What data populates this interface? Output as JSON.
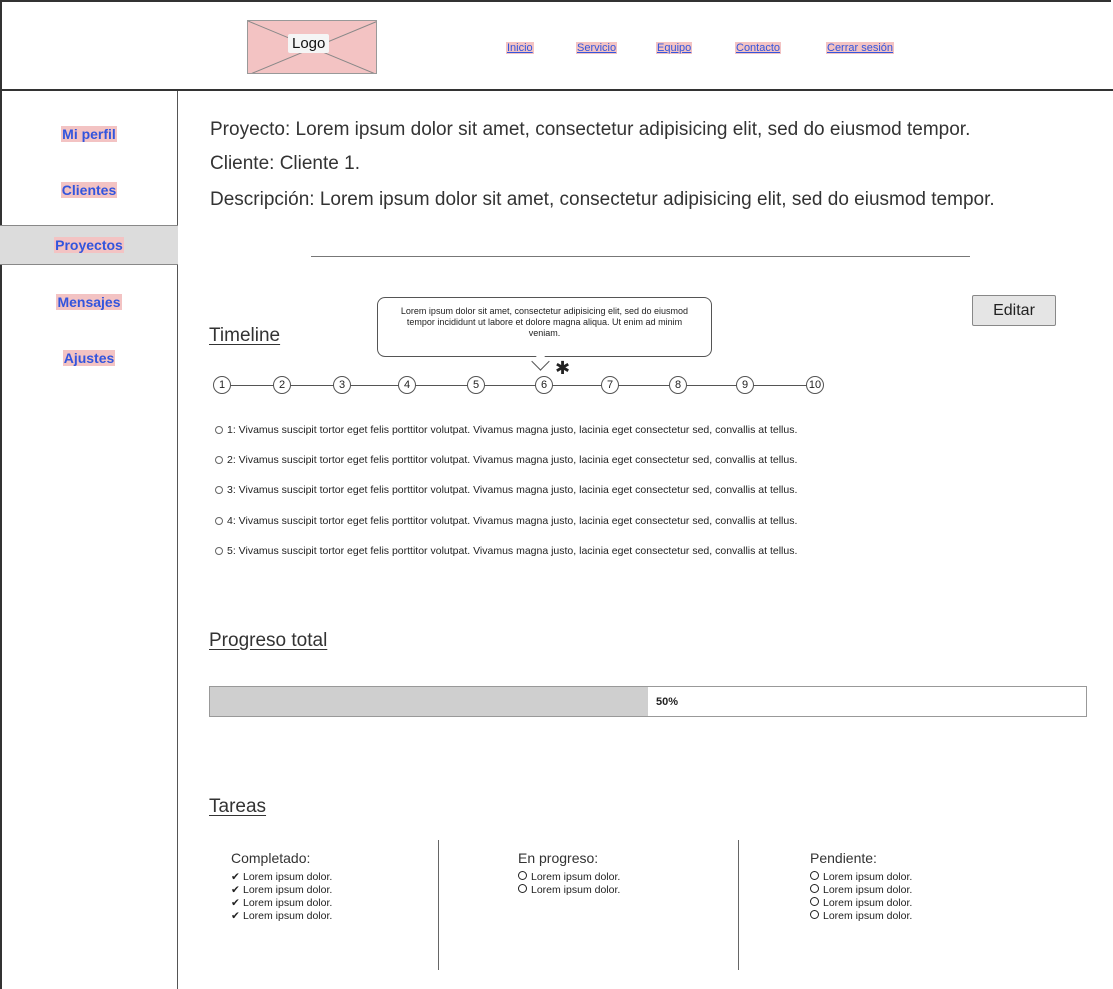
{
  "header": {
    "logo": "Logo",
    "nav": [
      "Inicio",
      "Servicio",
      "Equipo",
      "Contacto",
      "Cerrar sesión"
    ]
  },
  "sidebar": {
    "items": [
      {
        "label": "Mi perfil",
        "active": false
      },
      {
        "label": "Clientes",
        "active": false
      },
      {
        "label": "Proyectos",
        "active": true
      },
      {
        "label": "Mensajes",
        "active": false
      },
      {
        "label": "Ajustes",
        "active": false
      }
    ]
  },
  "project": {
    "proyecto": "Proyecto: Lorem ipsum dolor sit amet, consectetur adipisicing elit, sed do eiusmod tempor.",
    "cliente": "Cliente: Cliente 1.",
    "descripcion": "Descripción: Lorem ipsum dolor sit amet, consectetur adipisicing elit, sed do eiusmod tempor."
  },
  "timeline": {
    "title": "Timeline",
    "edit_label": "Editar",
    "tooltip": "Lorem ipsum dolor sit amet, consectetur adipisicing elit, sed do eiusmod tempor incididunt ut labore et dolore magna aliqua. Ut enim ad minim veniam.",
    "marker": "✱",
    "nodes": [
      "1",
      "2",
      "3",
      "4",
      "5",
      "6",
      "7",
      "8",
      "9",
      "10"
    ],
    "items": [
      "1: Vivamus suscipit tortor eget felis porttitor volutpat. Vivamus magna justo, lacinia eget consectetur sed, convallis at tellus.",
      "2: Vivamus suscipit tortor eget felis porttitor volutpat. Vivamus magna justo, lacinia eget consectetur sed, convallis at tellus.",
      "3: Vivamus suscipit tortor eget felis porttitor volutpat. Vivamus magna justo, lacinia eget consectetur sed, convallis at tellus.",
      "4: Vivamus suscipit tortor eget felis porttitor volutpat. Vivamus magna justo, lacinia eget consectetur sed, convallis at tellus.",
      "5: Vivamus suscipit tortor eget felis porttitor volutpat. Vivamus magna justo, lacinia eget consectetur sed, convallis at tellus."
    ]
  },
  "progress": {
    "title": "Progreso total",
    "value": 0.5,
    "label": "50%"
  },
  "tasks": {
    "title": "Tareas",
    "columns": [
      {
        "heading": "Completado:",
        "status": "done",
        "items": [
          "Lorem ipsum dolor.",
          "Lorem ipsum dolor.",
          "Lorem ipsum dolor.",
          "Lorem ipsum dolor."
        ]
      },
      {
        "heading": "En progreso:",
        "status": "open",
        "items": [
          "Lorem ipsum dolor.",
          "Lorem ipsum dolor."
        ]
      },
      {
        "heading": "Pendiente:",
        "status": "open",
        "items": [
          "Lorem ipsum dolor.",
          "Lorem ipsum dolor.",
          "Lorem ipsum dolor.",
          "Lorem ipsum dolor."
        ]
      }
    ]
  },
  "colors": {
    "link": "#3355dd",
    "highlight": "#f3c3c3",
    "active_bg": "#dcdcdc",
    "progress_fill": "#cfcfcf"
  }
}
